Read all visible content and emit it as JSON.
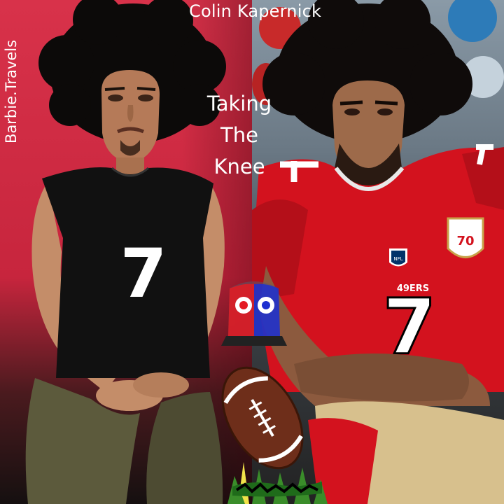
{
  "image": {
    "title": "Colin Kapernick",
    "caption_lines": [
      "Taking",
      "The",
      "Knee"
    ],
    "side_tag": "Barbie.Travels",
    "left_photo": {
      "jersey_number": "7"
    },
    "right_photo": {
      "jersey_number": "7",
      "sleeve_number": "7",
      "team_wordmark": "49ERS",
      "shield_number": "70",
      "league_logo": "NFL"
    },
    "stickers": {
      "siren": "police-siren-icon",
      "football": "american-football-icon",
      "grass_logo": "grass-text-logo"
    },
    "colors": {
      "left_background": "#d32f47",
      "jersey_red": "#d3121e",
      "doll_shirt": "#111111",
      "pants_olive": "#5c5a3c",
      "siren_red": "#e41b23",
      "siren_blue": "#1d2fd0",
      "football_brown": "#6e2e1a",
      "text": "#ffffff"
    }
  }
}
